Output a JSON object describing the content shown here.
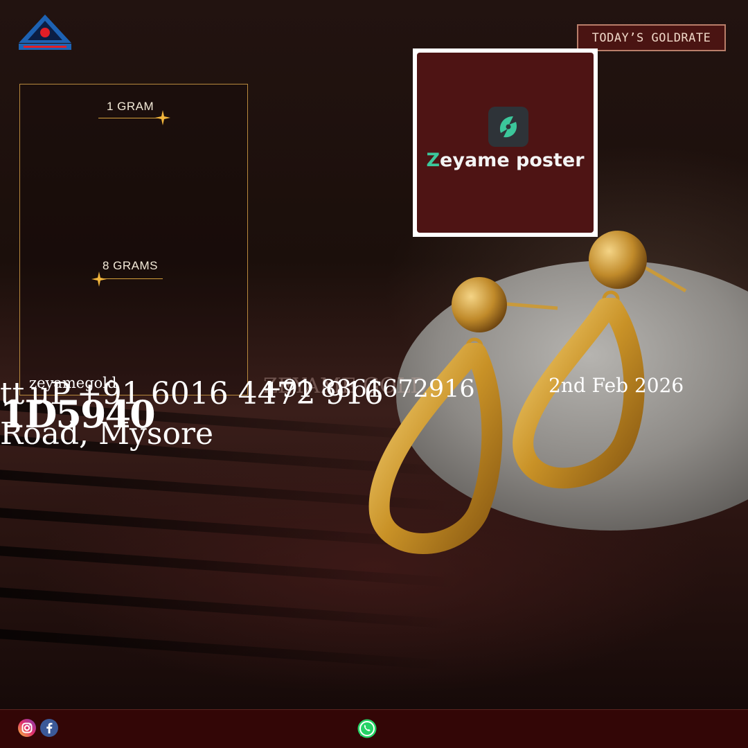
{
  "rate_badge": {
    "label": "TODAY’S GOLDRATE"
  },
  "rates": [
    {
      "weight": "1 GRAM"
    },
    {
      "weight": "8 GRAMS"
    }
  ],
  "poster": {
    "icon": "zeyame-poster-app-icon",
    "name_initial": "Z",
    "name_rest": "eyame poster"
  },
  "overlays": {
    "phone_primary": "tt uP +91 6016 4472 916",
    "phone_secondary": "+91 8861672916",
    "faint_brand": "ZEYAME GOLD",
    "date": "2nd Feb 2026",
    "handle": "zeyamegold",
    "code": "1D5940",
    "address": "Road, Mysore"
  },
  "footer": {
    "icons": [
      "instagram-icon",
      "facebook-icon",
      "whatsapp-icon"
    ]
  },
  "colors": {
    "accent_gold": "#d7a13c",
    "badge_bg": "#4a1412",
    "poster_bg": "#4e1414",
    "footer_bg": "#330606",
    "brand_green": "#3cc79b"
  }
}
